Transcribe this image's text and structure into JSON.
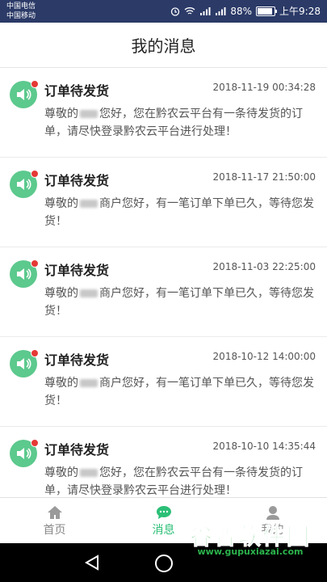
{
  "status": {
    "carrier1": "中国电信",
    "carrier2": "中国移动",
    "battery": "88%",
    "time": "上午9:28"
  },
  "header": {
    "title": "我的消息"
  },
  "messages": [
    {
      "title": "订单待发货",
      "time": "2018-11-19 00:34:28",
      "prefix": "尊敬的",
      "suffix": "您好，您在黔农云平台有一条待发货的订单，请尽快登录黔农云平台进行处理！"
    },
    {
      "title": "订单待发货",
      "time": "2018-11-17 21:50:00",
      "prefix": "尊敬的",
      "suffix": "商户您好，有一笔订单下单已久，等待您发货！"
    },
    {
      "title": "订单待发货",
      "time": "2018-11-03 22:25:00",
      "prefix": "尊敬的",
      "suffix": "商户您好，有一笔订单下单已久，等待您发货！"
    },
    {
      "title": "订单待发货",
      "time": "2018-10-12 14:00:00",
      "prefix": "尊敬的",
      "suffix": "商户您好，有一笔订单下单已久，等待您发货！"
    },
    {
      "title": "订单待发货",
      "time": "2018-10-10 14:35:44",
      "prefix": "尊敬的",
      "suffix": "您好，您在黔农云平台有一条待发货的订单，请尽快登录黔农云平台进行处理！"
    }
  ],
  "tabs": {
    "home": "首页",
    "messages": "消息",
    "mine": "我的",
    "active": "messages"
  },
  "watermark": {
    "main": "谷普软件园",
    "sub": "www.gupuxiazai.com"
  },
  "colors": {
    "accent": "#2bbf76",
    "avatar": "#5cc98d",
    "unread_dot": "#e53935",
    "statusbar": "#2b3a67"
  },
  "icons": {
    "message_avatar": "speaker-icon",
    "tab_home": "house-icon",
    "tab_messages": "chat-bubble-icon",
    "tab_mine": "person-icon"
  }
}
